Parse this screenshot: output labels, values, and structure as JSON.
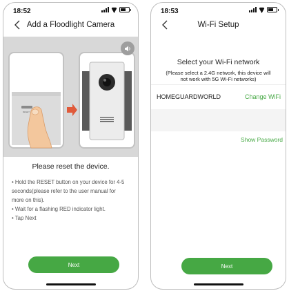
{
  "left_screen": {
    "status_time": "18:52",
    "title": "Add a Floodlight Camera",
    "heading": "Please reset the device.",
    "instructions": [
      "• Hold the RESET button on your device for 4-5",
      "seconds(please refer to the user manual for",
      "more on this).",
      "• Wait for a flashing RED indicator light.",
      "• Tap Next"
    ],
    "button_label": "Next"
  },
  "right_screen": {
    "status_time": "18:53",
    "title": "Wi-Fi Setup",
    "heading": "Select your Wi-Fi network",
    "note_line1": "(Please select a 2.4G network, this device will",
    "note_line2": "not work with 5G Wi-Fi networks)",
    "network_name": "HOMEGUARDWORLD",
    "change_wifi_label": "Change WiFi",
    "password_value": "",
    "show_password_label": "Show Password",
    "button_label": "Next"
  },
  "colors": {
    "accent": "#46a844",
    "illustration_bg": "#d8d8d8",
    "arrow": "#e05a3a"
  },
  "icons": [
    "back-chevron-icon",
    "cellular-signal-icon",
    "wifi-icon",
    "battery-icon",
    "speaker-icon"
  ]
}
